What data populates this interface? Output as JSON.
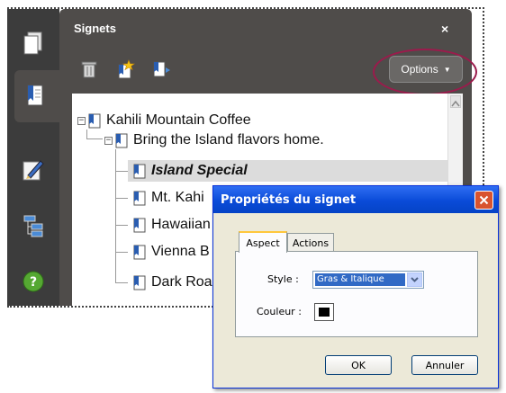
{
  "panel": {
    "title": "Signets",
    "close_glyph": "×",
    "options_label": "Options"
  },
  "left_toolbar": {
    "items": [
      "pages-icon",
      "bookmarks-icon",
      "signatures-icon",
      "layers-icon",
      "help-icon"
    ],
    "help_glyph": "?"
  },
  "bookmarks_toolbar": [
    "delete-icon",
    "new-bookmark-icon",
    "expand-bookmark-icon"
  ],
  "tree": {
    "items": [
      {
        "label": "Kahili Mountain Coffee",
        "level": 0,
        "expander": "−"
      },
      {
        "label": "Bring the Island flavors home.",
        "level": 1,
        "expander": "−"
      },
      {
        "label": "Island Special",
        "level": 2,
        "selected": true,
        "bold_italic": true
      },
      {
        "label": "Mt. Kahi",
        "level": 2
      },
      {
        "label": "Hawaiian",
        "level": 2
      },
      {
        "label": "Vienna B",
        "level": 2
      },
      {
        "label": "Dark Roa",
        "level": 2
      }
    ]
  },
  "dialog": {
    "title": "Propriétés du signet",
    "tabs": [
      "Aspect",
      "Actions"
    ],
    "style_label": "Style :",
    "style_value": "Gras & Italique",
    "color_label": "Couleur :",
    "color_value": "#000000",
    "ok_label": "OK",
    "cancel_label": "Annuler"
  },
  "colors": {
    "panel_bg": "#4f4c4a",
    "toolbar_bg": "#3c3c3c",
    "accent_ring": "#9b1b4c",
    "xp_title_blue": "#0a4bd8"
  }
}
